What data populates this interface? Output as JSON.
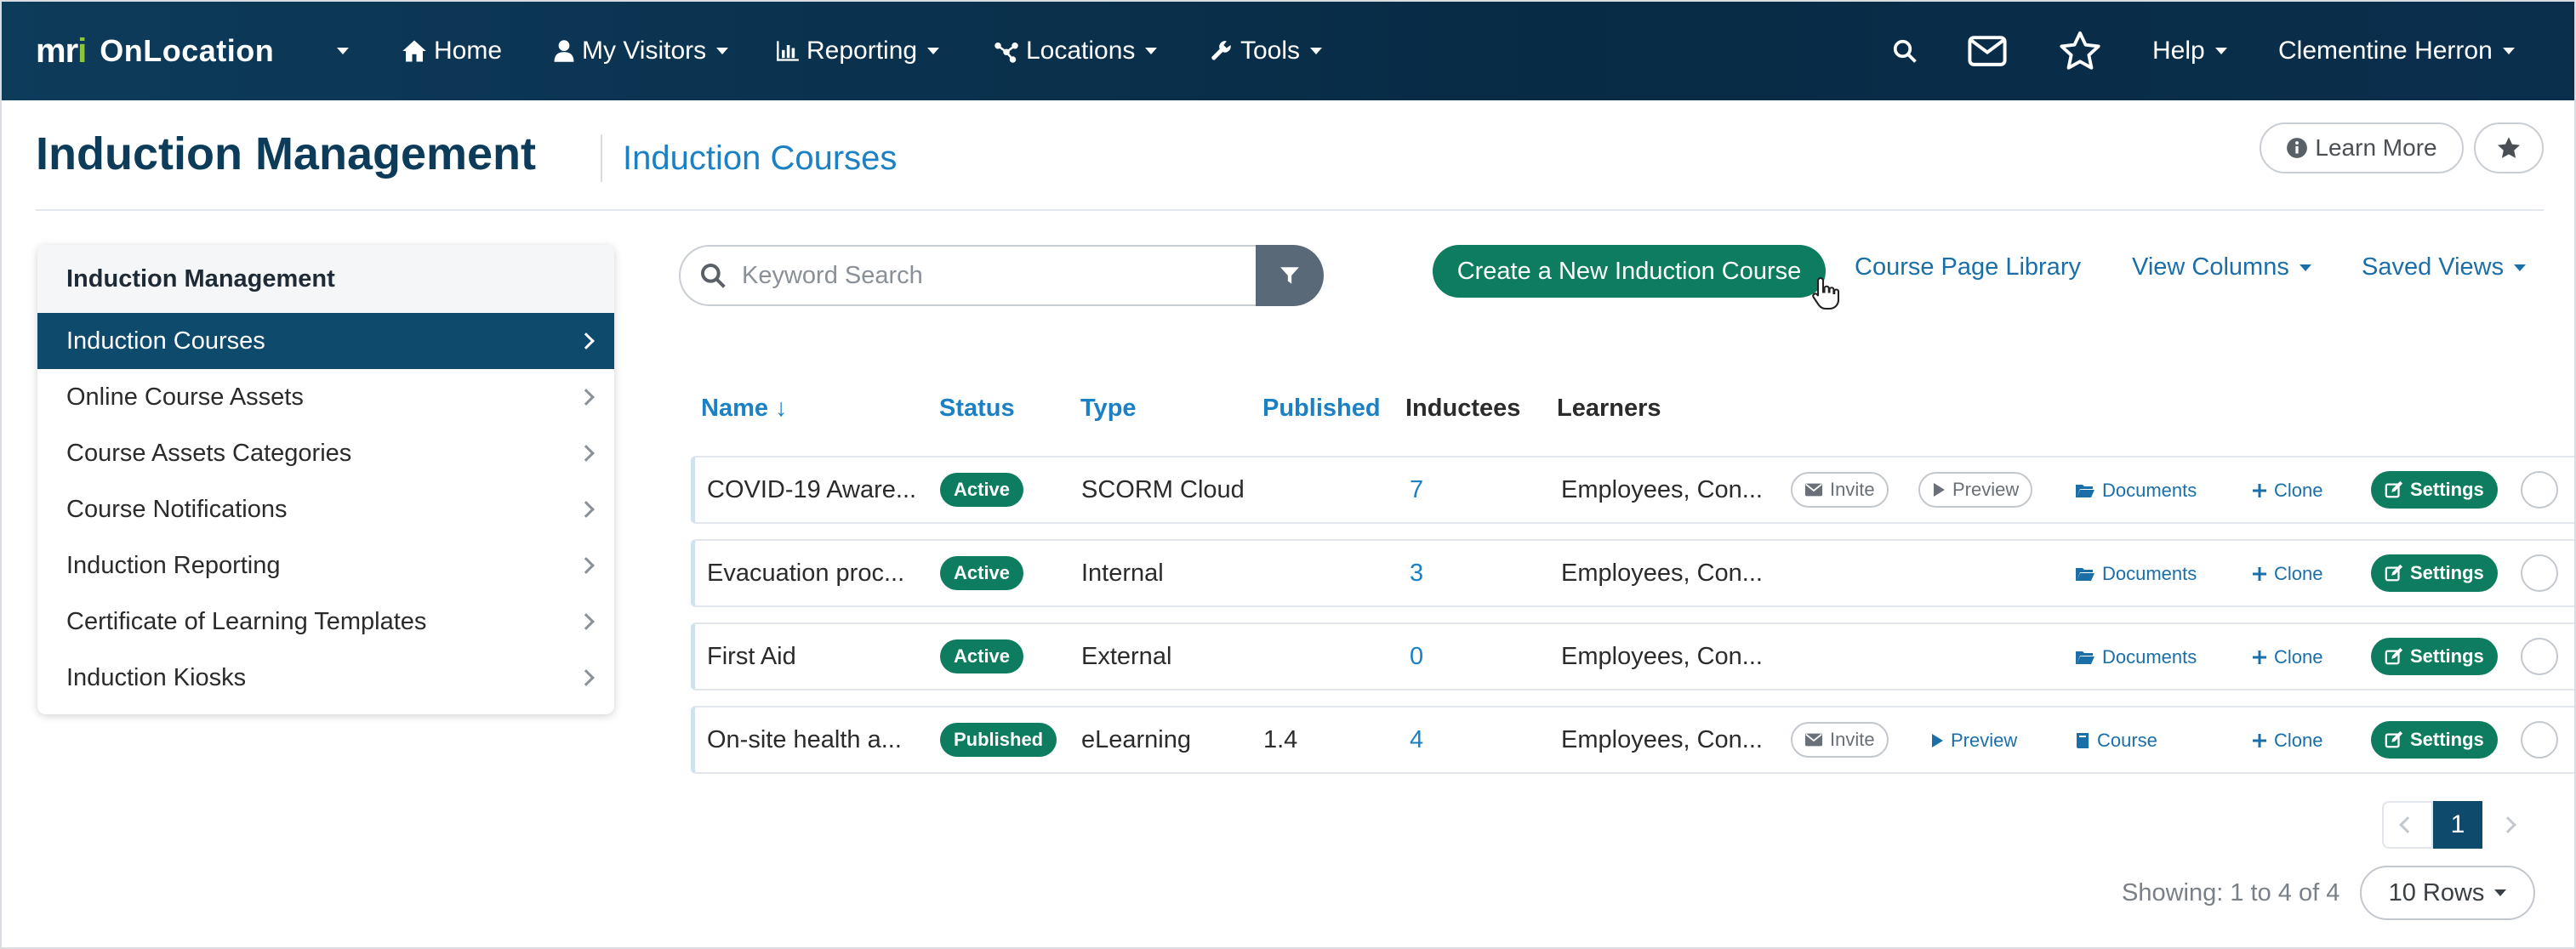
{
  "navbar": {
    "logo_mark": "mri",
    "logo_text": "OnLocation",
    "items": [
      {
        "label": "Home"
      },
      {
        "label": "My Visitors"
      },
      {
        "label": "Reporting"
      },
      {
        "label": "Locations"
      },
      {
        "label": "Tools"
      }
    ],
    "help": "Help",
    "user": "Clementine Herron"
  },
  "header": {
    "title": "Induction Management",
    "subtitle": "Induction Courses",
    "learn_more": "Learn More"
  },
  "sidebar": {
    "heading": "Induction Management",
    "items": [
      {
        "label": "Induction Courses",
        "active": true
      },
      {
        "label": "Online Course Assets"
      },
      {
        "label": "Course Assets Categories"
      },
      {
        "label": "Course Notifications"
      },
      {
        "label": "Induction Reporting"
      },
      {
        "label": "Certificate of Learning Templates"
      },
      {
        "label": "Induction Kiosks"
      }
    ]
  },
  "toolbar": {
    "search_placeholder": "Keyword Search",
    "create_button": "Create a New Induction Course",
    "course_page_library": "Course Page Library",
    "view_columns": "View Columns",
    "saved_views": "Saved Views"
  },
  "table": {
    "columns": {
      "name": "Name ↓",
      "status": "Status",
      "type": "Type",
      "published": "Published",
      "inductees": "Inductees",
      "learners": "Learners"
    },
    "rows": [
      {
        "name": "COVID-19 Aware...",
        "status": "Active",
        "type": "SCORM Cloud",
        "published": "",
        "inductees": "7",
        "learners": "Employees, Con...",
        "invite": "Invite",
        "preview": "Preview",
        "resource": "Documents",
        "clone": "Clone",
        "settings": "Settings"
      },
      {
        "name": "Evacuation proc...",
        "status": "Active",
        "type": "Internal",
        "published": "",
        "inductees": "3",
        "learners": "Employees, Con...",
        "resource": "Documents",
        "clone": "Clone",
        "settings": "Settings"
      },
      {
        "name": "First Aid",
        "status": "Active",
        "type": "External",
        "published": "",
        "inductees": "0",
        "learners": "Employees, Con...",
        "resource": "Documents",
        "clone": "Clone",
        "settings": "Settings"
      },
      {
        "name": "On-site health a...",
        "status": "Published",
        "type": "eLearning",
        "published": "1.4",
        "inductees": "4",
        "learners": "Employees, Con...",
        "invite": "Invite",
        "preview": "Preview",
        "resource": "Course",
        "clone": "Clone",
        "settings": "Settings"
      }
    ]
  },
  "pagination": {
    "current_page": "1",
    "showing": "Showing: 1 to 4 of 4",
    "rows_per_page": "10 Rows"
  },
  "colors": {
    "navbar": "#0d3b5a",
    "accent_green": "#0e7d5f",
    "link_blue": "#1b80c4",
    "sidebar_active": "#0d4a6b"
  }
}
